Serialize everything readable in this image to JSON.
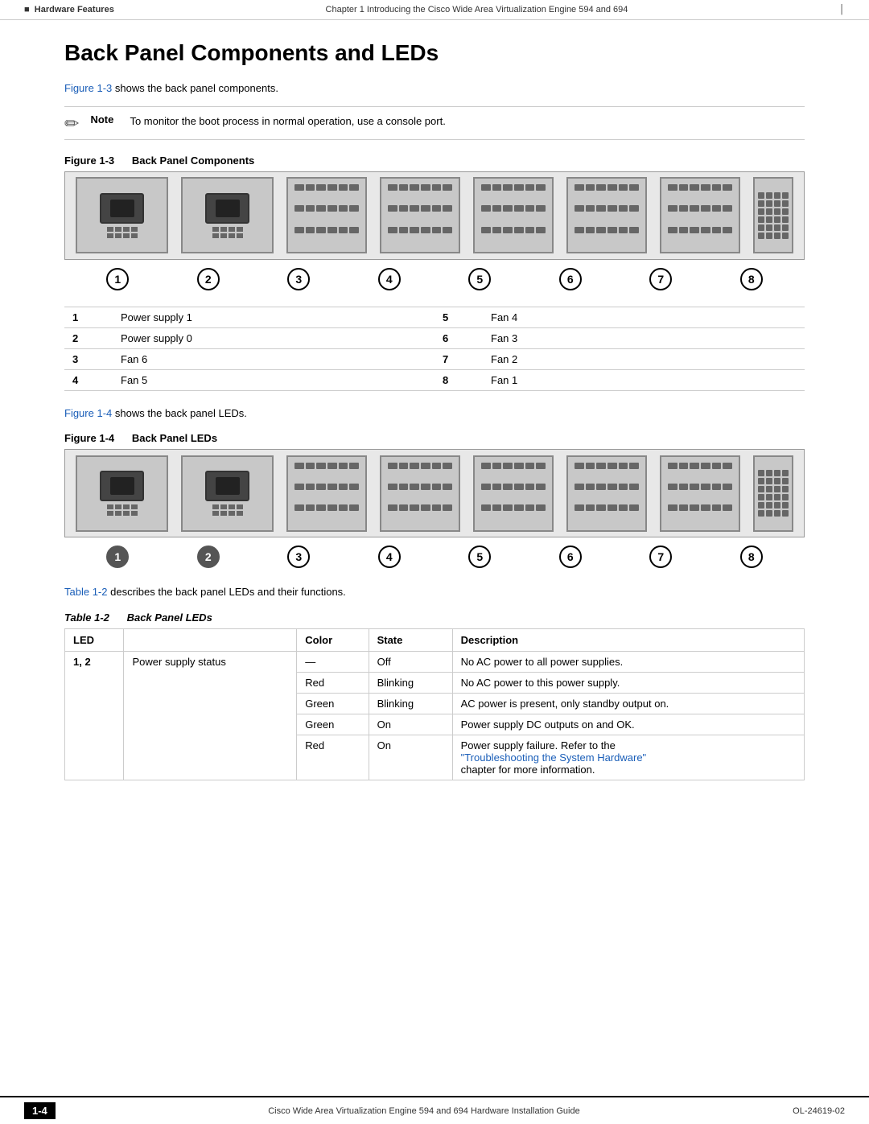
{
  "header": {
    "left": "Hardware Features",
    "center": "Chapter 1    Introducing the Cisco Wide Area Virtualization Engine 594 and 694",
    "left_marker": "■"
  },
  "section": {
    "title": "Back Panel Components and LEDs"
  },
  "intro_para": "Figure 1-3 shows the back panel components.",
  "intro_para_link": "Figure 1-3",
  "note": {
    "label": "Note",
    "text": "To monitor the boot process in normal operation, use a console port."
  },
  "figure1": {
    "number": "1-3",
    "title": "Back Panel Components"
  },
  "numbers1": [
    "1",
    "2",
    "3",
    "4",
    "5",
    "6",
    "7",
    "8"
  ],
  "components": [
    {
      "num": "1",
      "label": "Power supply 1",
      "num2": "5",
      "label2": "Fan 4"
    },
    {
      "num": "2",
      "label": "Power supply 0",
      "num2": "6",
      "label2": "Fan 3"
    },
    {
      "num": "3",
      "label": "Fan 6",
      "num2": "7",
      "label2": "Fan 2"
    },
    {
      "num": "4",
      "label": "Fan 5",
      "num2": "8",
      "label2": "Fan 1"
    }
  ],
  "para2": "Figure 1-4 shows the back panel LEDs.",
  "para2_link": "Figure 1-4",
  "figure2": {
    "number": "1-4",
    "title": "Back Panel LEDs"
  },
  "numbers2": [
    "1",
    "2",
    "3",
    "4",
    "5",
    "6",
    "7",
    "8"
  ],
  "table_intro": "Table 1-2 describes the back panel LEDs and their functions.",
  "table_intro_link": "Table 1-2",
  "table_label": {
    "number": "1-2",
    "title": "Back Panel LEDs"
  },
  "led_table": {
    "headers": [
      "LED",
      "",
      "Color",
      "State",
      "Description"
    ],
    "rows": [
      {
        "led": "1, 2",
        "desc_label": "Power supply status",
        "color": "—",
        "state": "Off",
        "description": "No AC power to all power supplies."
      },
      {
        "led": "",
        "desc_label": "",
        "color": "Red",
        "state": "Blinking",
        "description": "No AC power to this power supply."
      },
      {
        "led": "",
        "desc_label": "",
        "color": "Green",
        "state": "Blinking",
        "description": "AC power is present, only standby output on."
      },
      {
        "led": "",
        "desc_label": "",
        "color": "Green",
        "state": "On",
        "description": "Power supply DC outputs on and OK."
      },
      {
        "led": "",
        "desc_label": "",
        "color": "Red",
        "state": "On",
        "description": "Power supply failure. Refer to the\n\"Troubleshooting the System Hardware\"\nchapter for more information.",
        "link_text": "\"Troubleshooting the System Hardware\""
      }
    ]
  },
  "footer": {
    "page": "1-4",
    "center": "Cisco Wide Area Virtualization Engine 594 and 694 Hardware Installation Guide",
    "right": "OL-24619-02"
  }
}
